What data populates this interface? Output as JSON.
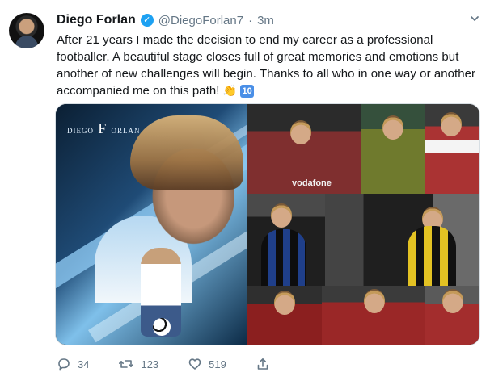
{
  "tweet": {
    "author_name": "Diego Forlan",
    "author_handle": "@DiegoForlan7",
    "dot": "·",
    "time": "3m",
    "text_main": "After 21 years I made the decision to end my career as a professional footballer. A beautiful stage closes full of great memories and emotions but another of new challenges will begin. Thanks to all who in one way or another accompanied me on this path!",
    "emoji_hand": "👏",
    "emoji_ten": "10",
    "media_logo_left": "DIEGO",
    "media_logo_mid": "F",
    "media_logo_right": "ORLAN",
    "tile_text_1": "vodafone",
    "actions": {
      "reply_count": "34",
      "retweet_count": "123",
      "like_count": "519"
    }
  },
  "icons": {
    "verified": "verified-badge-icon",
    "chevron": "chevron-down-icon",
    "reply": "reply-icon",
    "retweet": "retweet-icon",
    "like": "heart-icon",
    "share": "share-icon"
  },
  "colors": {
    "verified_blue": "#1da1f2",
    "muted_text": "#657786"
  }
}
